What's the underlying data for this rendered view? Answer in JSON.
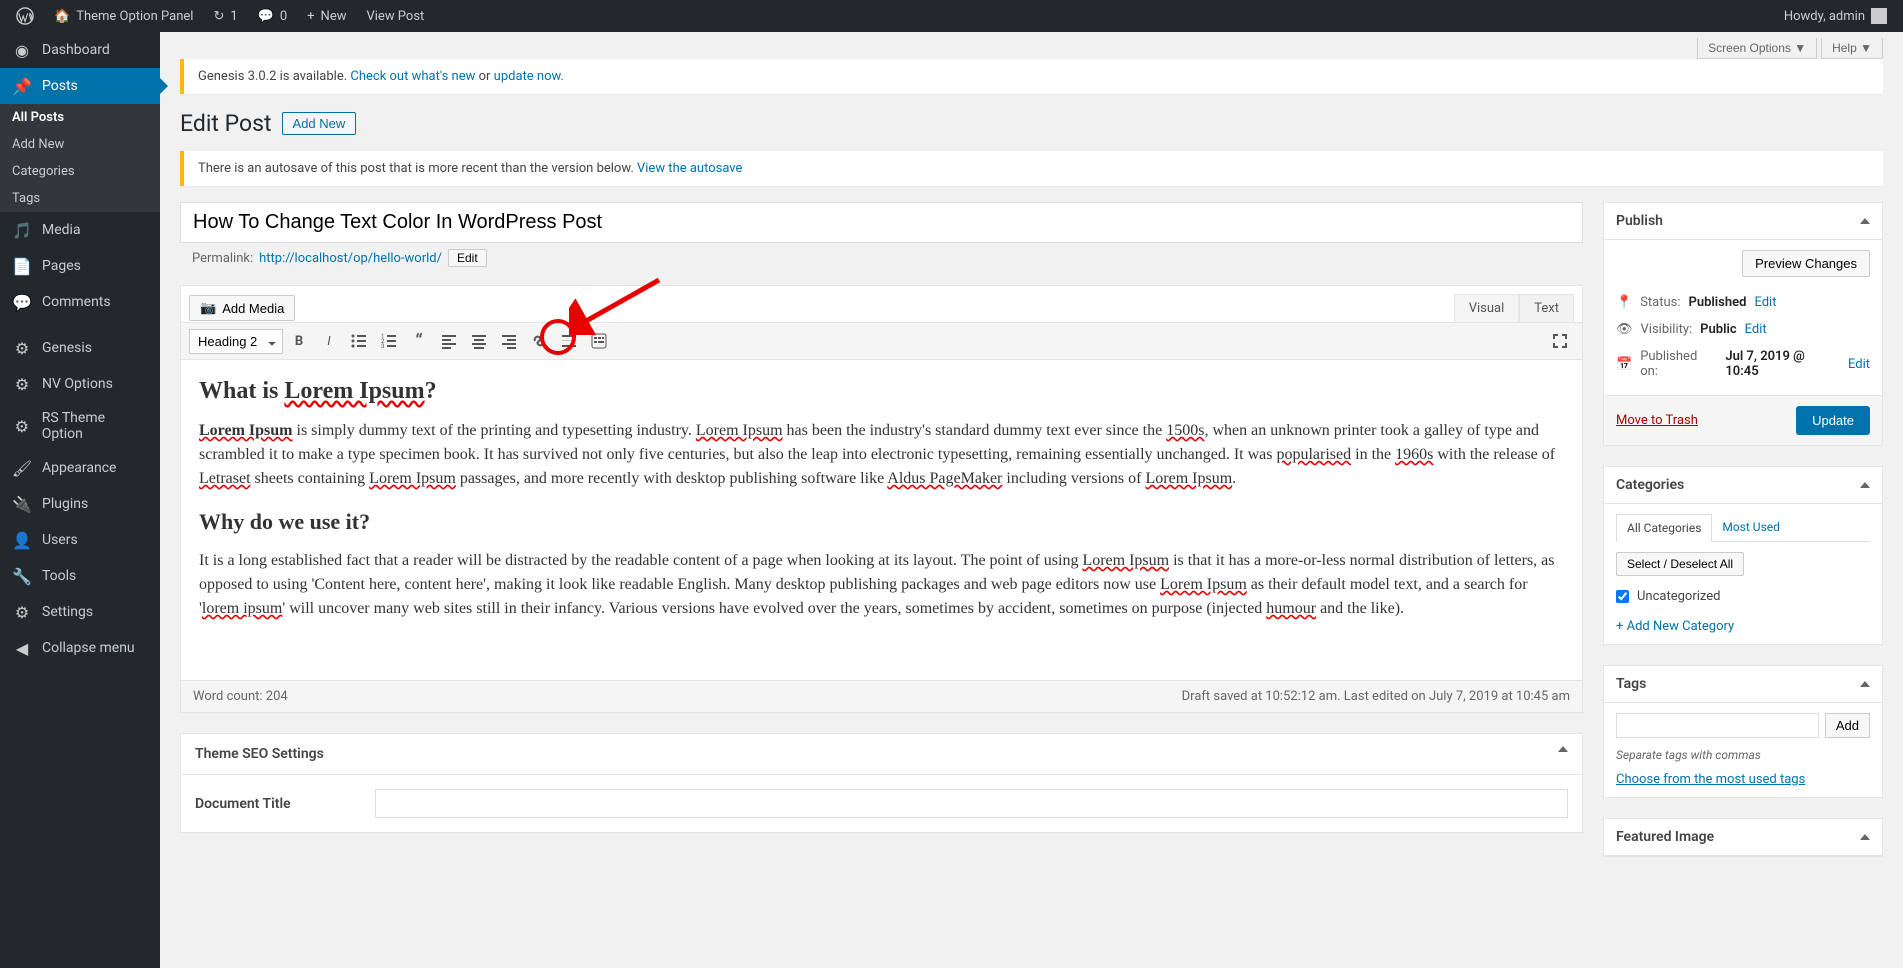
{
  "admin_bar": {
    "site_name": "Theme Option Panel",
    "updates": "1",
    "comments": "0",
    "new": "New",
    "view_post": "View Post",
    "howdy": "Howdy, admin"
  },
  "sidebar": {
    "items": [
      {
        "label": "Dashboard",
        "icon": "dashboard"
      },
      {
        "label": "Posts",
        "icon": "pin",
        "active": true,
        "sub": [
          {
            "label": "All Posts",
            "current": true
          },
          {
            "label": "Add New"
          },
          {
            "label": "Categories"
          },
          {
            "label": "Tags"
          }
        ]
      },
      {
        "label": "Media",
        "icon": "media"
      },
      {
        "label": "Pages",
        "icon": "pages"
      },
      {
        "label": "Comments",
        "icon": "comments"
      },
      {
        "label": "Genesis",
        "icon": "genesis"
      },
      {
        "label": "NV Options",
        "icon": "gear"
      },
      {
        "label": "RS Theme Option",
        "icon": "gear"
      },
      {
        "label": "Appearance",
        "icon": "brush"
      },
      {
        "label": "Plugins",
        "icon": "plug"
      },
      {
        "label": "Users",
        "icon": "user"
      },
      {
        "label": "Tools",
        "icon": "wrench"
      },
      {
        "label": "Settings",
        "icon": "sliders"
      },
      {
        "label": "Collapse menu",
        "icon": "collapse"
      }
    ]
  },
  "top_buttons": {
    "screen_options": "Screen Options",
    "help": "Help"
  },
  "notices": {
    "genesis_text": "Genesis 3.0.2 is available. ",
    "genesis_link1": "Check out what's new",
    "genesis_or": " or ",
    "genesis_link2": "update now.",
    "autosave_text": "There is an autosave of this post that is more recent than the version below. ",
    "autosave_link": "View the autosave"
  },
  "page": {
    "title": "Edit Post",
    "add_new": "Add New"
  },
  "post": {
    "title": "How To Change Text Color In WordPress Post",
    "permalink_label": "Permalink:",
    "permalink_url": "http://localhost/op/hello-world/",
    "edit_btn": "Edit"
  },
  "editor": {
    "add_media": "Add Media",
    "visual_tab": "Visual",
    "text_tab": "Text",
    "format": "Heading 2",
    "word_count_label": "Word count: ",
    "word_count": "204",
    "draft_saved": "Draft saved at 10:52:12 am.",
    "last_edited": "Last edited on July 7, 2019 at 10:45 am"
  },
  "content": {
    "h2_pre": "What is ",
    "h2_spell": "Lorem Ipsum",
    "h2_post": "?",
    "p1_a": "Lorem Ipsum",
    "p1_b": " is simply dummy text of the printing and typesetting industry. ",
    "p1_c": "Lorem Ipsum",
    "p1_d": " has been the industry's standard dummy text ever since the ",
    "p1_e": "1500s",
    "p1_f": ", when an unknown printer took a galley of type and scrambled it to make a type specimen book. It has survived not only five centuries, but also the leap into electronic typesetting, remaining essentially unchanged. It was ",
    "p1_g": "popularised",
    "p1_h": " in the ",
    "p1_i": "1960s",
    "p1_j": " with the release of ",
    "p1_k": "Letraset",
    "p1_l": " sheets containing ",
    "p1_m": "Lorem Ipsum",
    "p1_n": " passages, and more recently with desktop publishing software like ",
    "p1_o": "Aldus PageMaker",
    "p1_p": " including versions of ",
    "p1_q": "Lorem Ipsum",
    "p1_r": ".",
    "h3": "Why do we use it?",
    "p2_a": "It is a long established fact that a reader will be distracted by the readable content of a page when looking at its layout. The point of using ",
    "p2_b": "Lorem Ipsum",
    "p2_c": " is that it has a more-or-less normal distribution of letters, as opposed to using 'Content here, content here', making it look like readable English. Many desktop publishing packages and web page editors now use ",
    "p2_d": "Lorem Ipsum",
    "p2_e": " as their default model text, and a search for '",
    "p2_f": "lorem ipsum",
    "p2_g": "' will uncover many web sites still in their infancy. Various versions have evolved over the years, sometimes by accident, sometimes on purpose (injected ",
    "p2_h": "humour",
    "p2_i": " and the like)."
  },
  "publish": {
    "title": "Publish",
    "preview": "Preview Changes",
    "status_label": "Status:",
    "status_val": "Published",
    "visibility_label": "Visibility:",
    "visibility_val": "Public",
    "published_label": "Published on:",
    "published_val": "Jul 7, 2019 @ 10:45",
    "edit": "Edit",
    "trash": "Move to Trash",
    "update": "Update"
  },
  "categories": {
    "title": "Categories",
    "tab_all": "All Categories",
    "tab_used": "Most Used",
    "select_all": "Select / Deselect All",
    "uncategorized": "Uncategorized",
    "add_new": "+ Add New Category"
  },
  "tags": {
    "title": "Tags",
    "add": "Add",
    "hint": "Separate tags with commas",
    "choose": "Choose from the most used tags"
  },
  "featured": {
    "title": "Featured Image"
  },
  "seo": {
    "title": "Theme SEO Settings",
    "doc_title": "Document Title"
  }
}
